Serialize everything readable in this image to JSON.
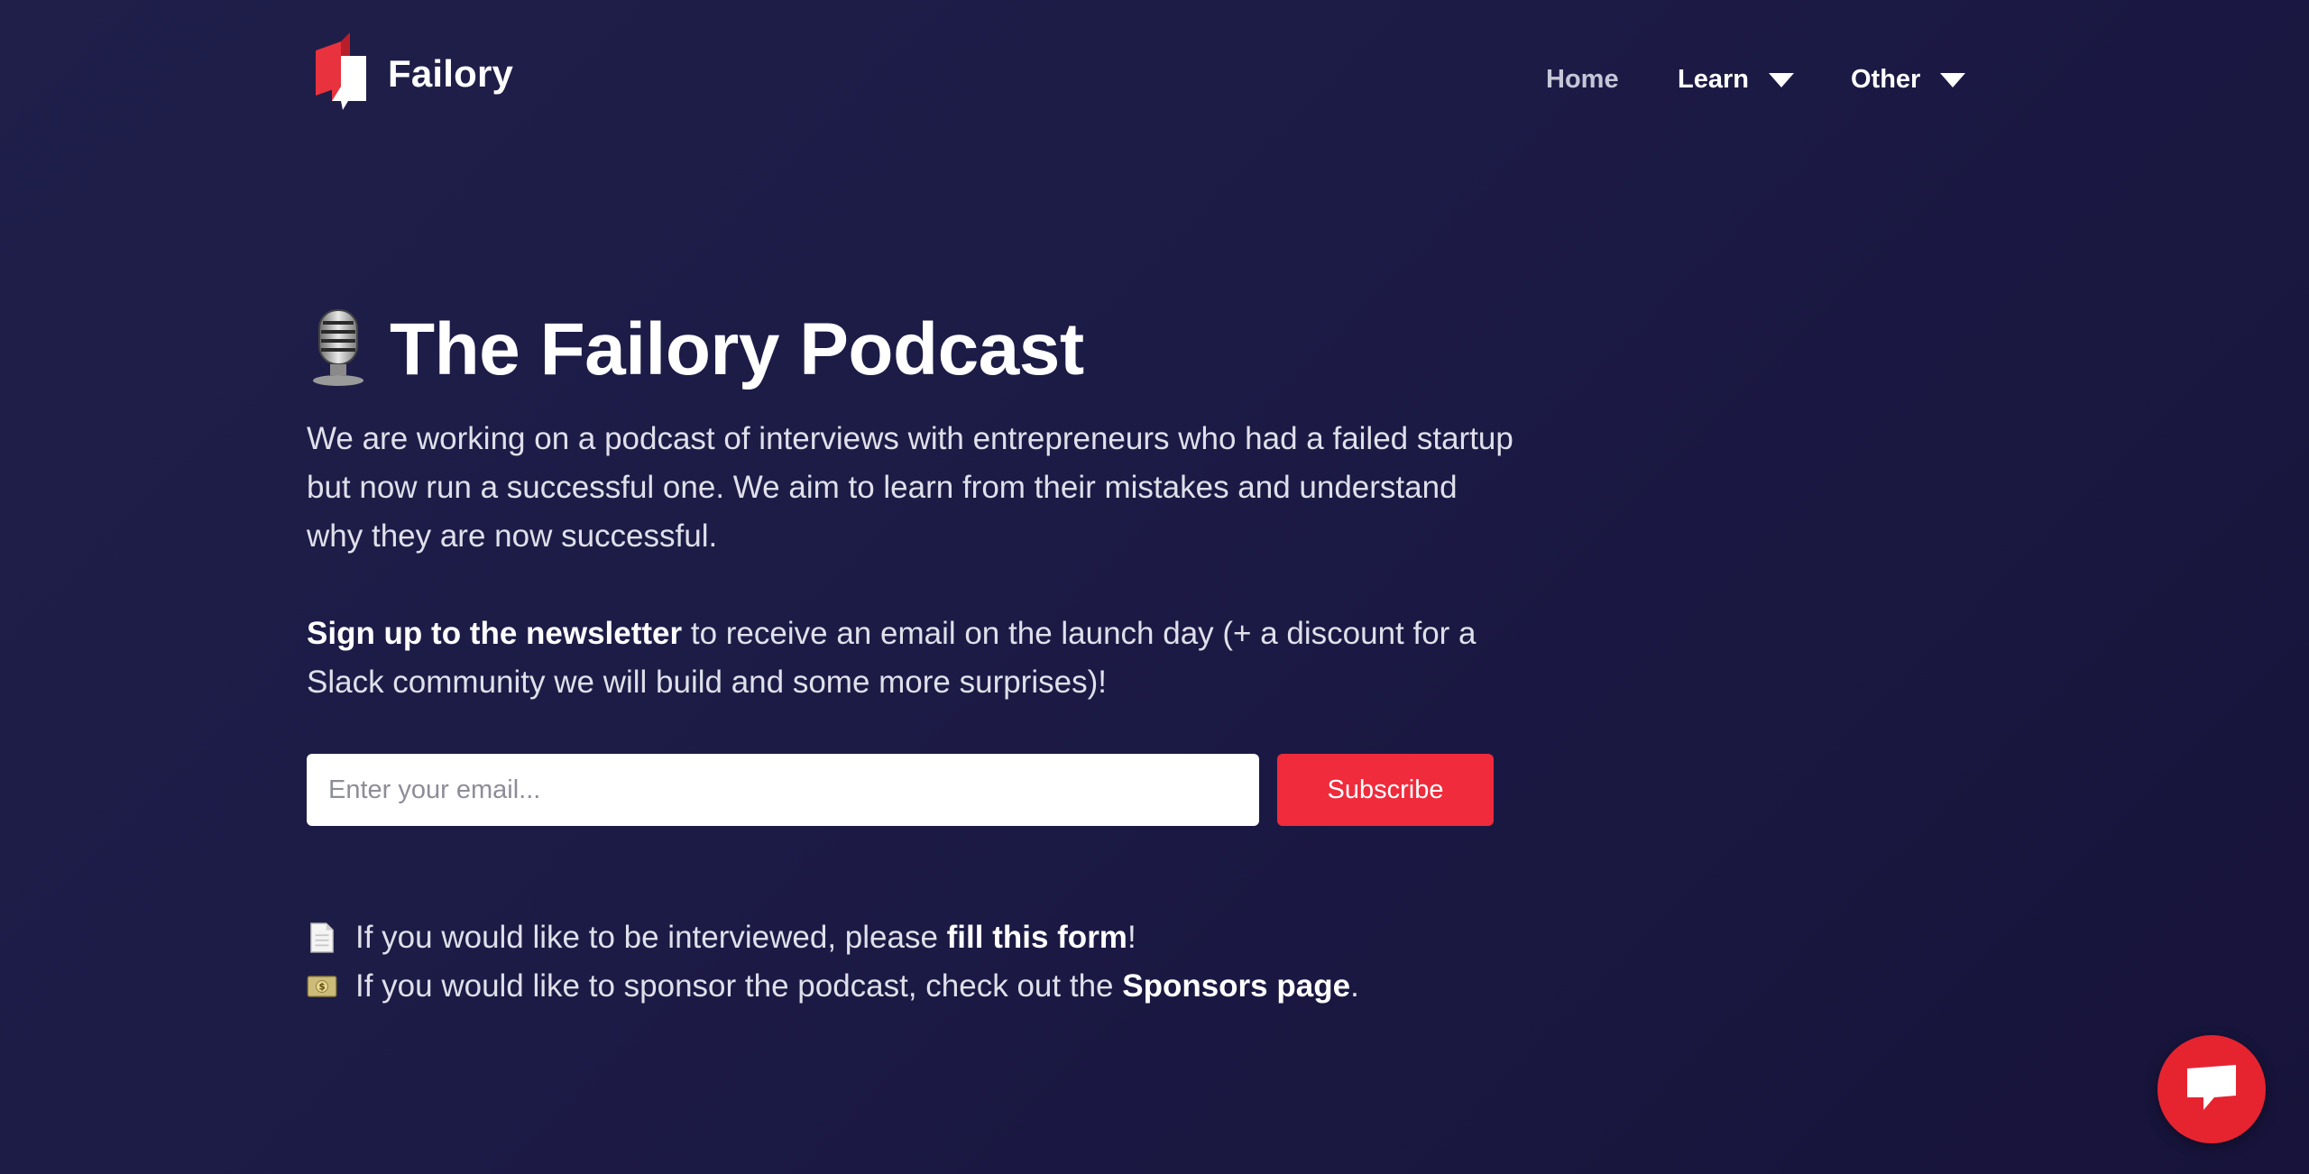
{
  "brand": {
    "name": "Failory",
    "accent": "#f02b3b"
  },
  "nav": {
    "items": [
      {
        "label": "Home",
        "has_dropdown": false
      },
      {
        "label": "Learn",
        "has_dropdown": true
      },
      {
        "label": "Other",
        "has_dropdown": true
      }
    ]
  },
  "hero": {
    "title": "The Failory Podcast",
    "title_icon": "microphone-icon",
    "description": "We are working on a podcast of interviews with entrepreneurs who had a failed startup but now run a successful one. We aim to learn from their mistakes and understand why they are now successful.",
    "signup_bold": "Sign up to the newsletter",
    "signup_rest": " to receive an email on the launch day (+ a discount for a Slack community we will build and some more surprises)!"
  },
  "subscribe_form": {
    "email_placeholder": "Enter your email...",
    "button_label": "Subscribe"
  },
  "links": [
    {
      "icon": "document-icon",
      "prefix": "If you would like to be interviewed, please ",
      "link_text": "fill this form",
      "suffix": "!"
    },
    {
      "icon": "money-icon",
      "prefix": "If you would like to sponsor the podcast, check out the ",
      "link_text": "Sponsors page",
      "suffix": "."
    }
  ],
  "chat": {
    "icon": "chat-bubble-icon",
    "color": "#e62430"
  }
}
